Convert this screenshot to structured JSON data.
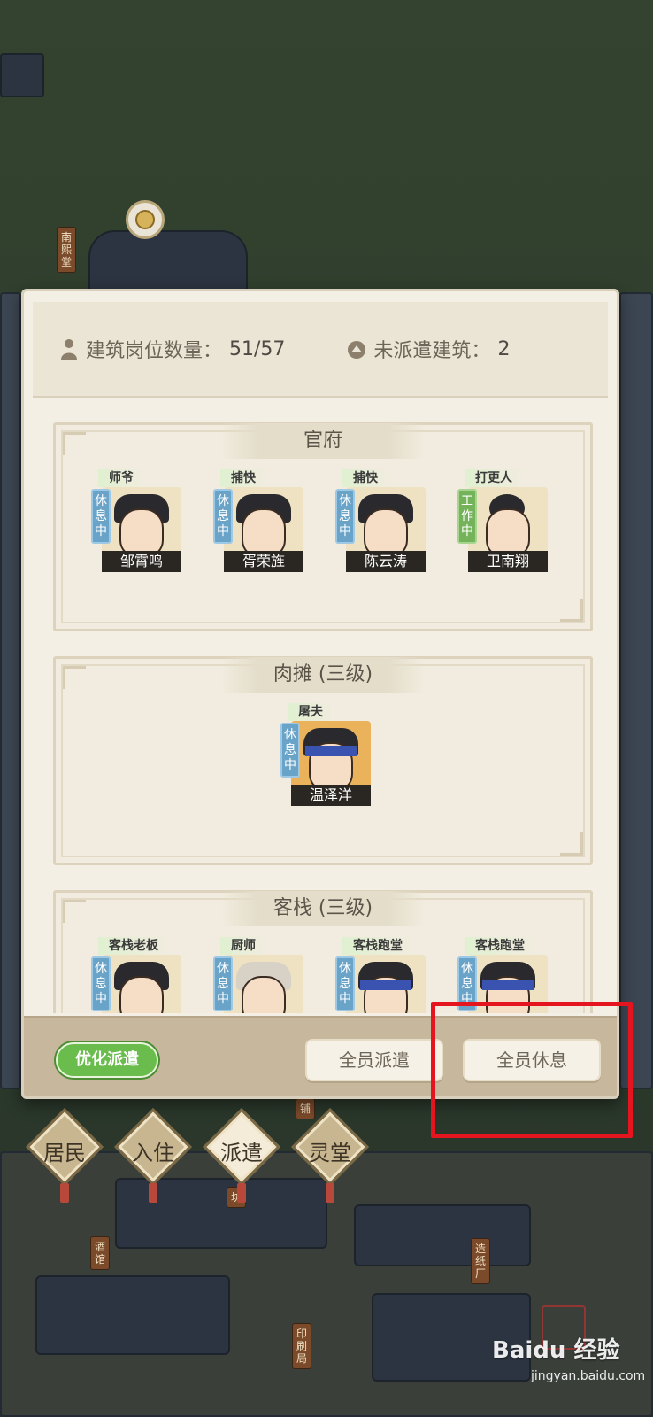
{
  "scene": {
    "signs": [
      "南熙堂",
      "酒馆",
      "铺",
      "坊",
      "印刷局",
      "造纸厂"
    ]
  },
  "stats": {
    "positions_label": "建筑岗位数量：",
    "positions_value": "51/57",
    "unassigned_label": "未派遣建筑：",
    "unassigned_value": "2"
  },
  "buildings": [
    {
      "title": "官府",
      "residents": [
        {
          "role": "师爷",
          "status": "休息中",
          "name": "邹霄鸣"
        },
        {
          "role": "捕快",
          "status": "休息中",
          "name": "胥荣旌"
        },
        {
          "role": "捕快",
          "status": "休息中",
          "name": "陈云涛"
        },
        {
          "role": "打更人",
          "status": "工作中",
          "name": "卫南翔"
        }
      ]
    },
    {
      "title": "肉摊 (三级)",
      "residents": [
        {
          "role": "屠夫",
          "status": "休息中",
          "name": "温泽洋"
        }
      ]
    },
    {
      "title": "客栈 (三级)",
      "residents": [
        {
          "role": "客栈老板",
          "status": "休息中",
          "name": ""
        },
        {
          "role": "厨师",
          "status": "休息中",
          "name": ""
        },
        {
          "role": "客栈跑堂",
          "status": "休息中",
          "name": ""
        },
        {
          "role": "客栈跑堂",
          "status": "休息中",
          "name": ""
        }
      ]
    }
  ],
  "actions": {
    "optimize": "优化派遣",
    "dispatch_all": "全员派遣",
    "rest_all": "全员休息"
  },
  "tabs": [
    "居民",
    "入住",
    "派遣",
    "灵堂"
  ],
  "active_tab": "派遣",
  "watermark": {
    "brand": "Baidu 经验",
    "url": "jingyan.baidu.com"
  },
  "colors": {
    "rest": "#6aa3c8",
    "work": "#74b35a",
    "optimize": "#6abc4d",
    "highlight": "#e4151e"
  }
}
